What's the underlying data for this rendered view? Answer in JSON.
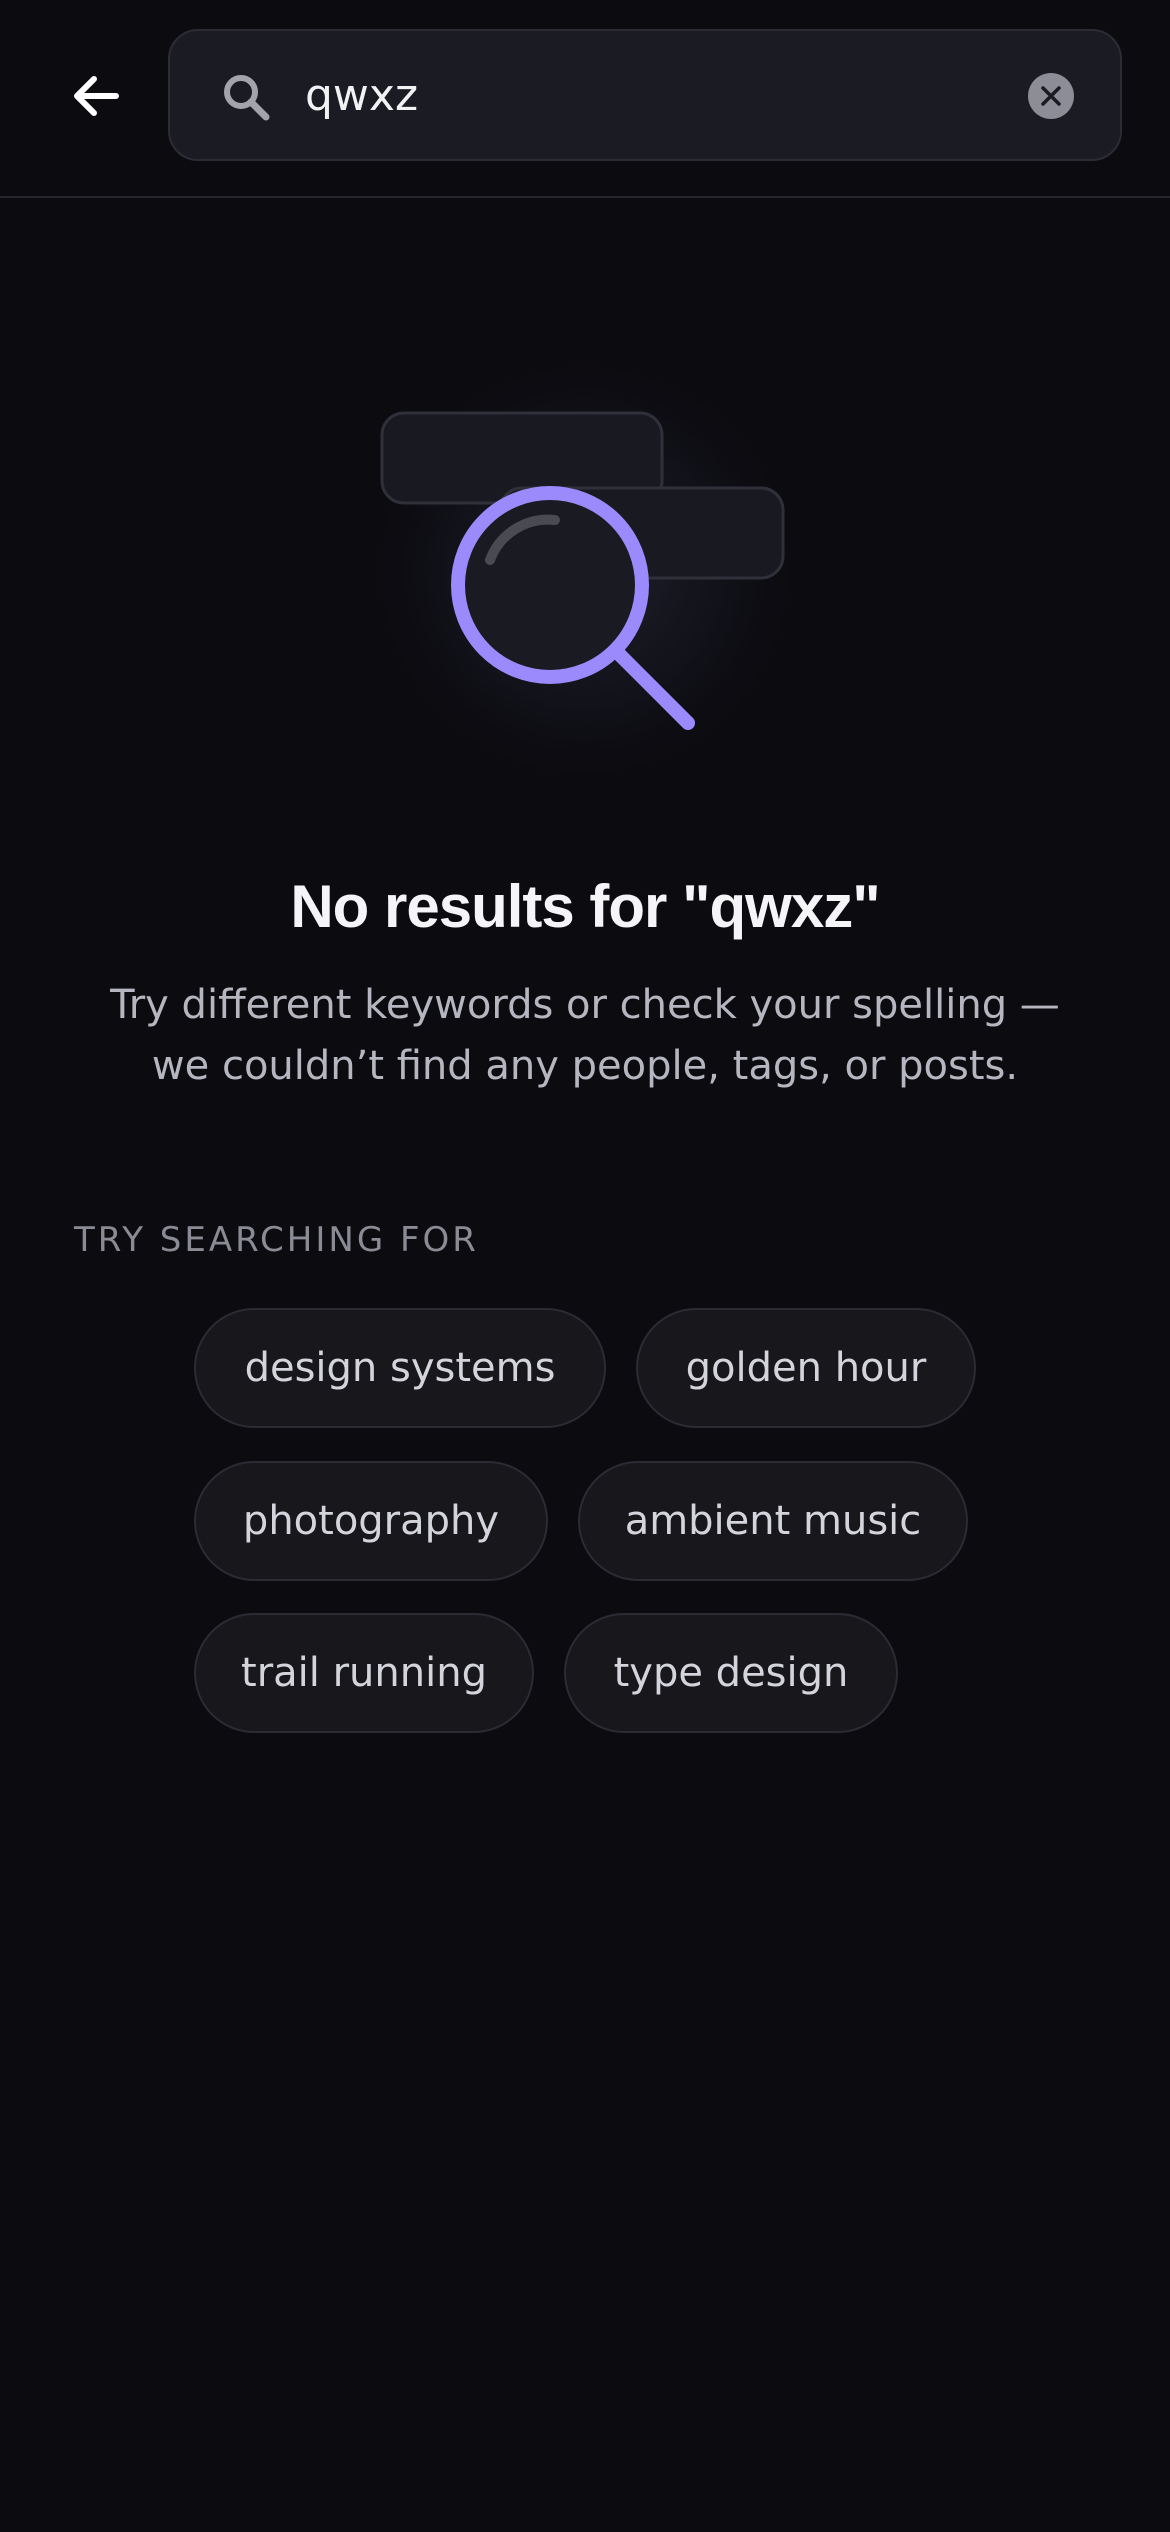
{
  "header": {
    "back_icon": "arrow-left-icon",
    "search": {
      "icon": "search-icon",
      "value": "qwxz",
      "clear_icon": "close-circle-icon"
    }
  },
  "empty_state": {
    "illustration_icon": "magnifier-icon",
    "title": "No results for \"qwxz\"",
    "subtitle_line1": "Try different keywords or check your spelling —",
    "subtitle_line2": "we couldn’t find any people, tags, or posts."
  },
  "suggestions": {
    "label": "TRY SEARCHING FOR",
    "items": [
      "design systems",
      "golden hour",
      "photography",
      "ambient music",
      "trail running",
      "type design"
    ]
  },
  "colors": {
    "background": "#0b0b10",
    "accent": "#9b8afb",
    "surface": "#1b1b23"
  }
}
